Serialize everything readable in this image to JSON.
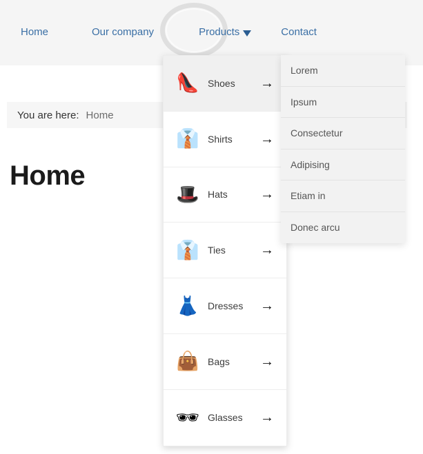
{
  "nav": {
    "items": [
      {
        "label": "Home",
        "has_caret": false
      },
      {
        "label": "Our company",
        "has_caret": false
      },
      {
        "label": "Products",
        "has_caret": true
      },
      {
        "label": "Contact",
        "has_caret": false
      }
    ],
    "active_item": "Products",
    "link_color": "#3a6fa5",
    "band_color": "#f5f5f5"
  },
  "highlight": {
    "target": "Products",
    "shape": "ring",
    "color": "#e2e2e2"
  },
  "breadcrumb": {
    "label": "You are here:",
    "current": "Home"
  },
  "page": {
    "title": "Home"
  },
  "dropdown": {
    "arrow_glyph": "→",
    "active_item": "Shoes",
    "items": [
      {
        "label": "Shoes",
        "icon": "high-heel-shoe-icon",
        "glyph": "👠",
        "active": true
      },
      {
        "label": "Shirts",
        "icon": "shirt-icon",
        "glyph": "👔",
        "active": false
      },
      {
        "label": "Hats",
        "icon": "hat-icon",
        "glyph": "🎩",
        "active": false
      },
      {
        "label": "Ties",
        "icon": "necktie-icon",
        "glyph": "👔",
        "active": false
      },
      {
        "label": "Dresses",
        "icon": "dress-icon",
        "glyph": "👗",
        "active": false
      },
      {
        "label": "Bags",
        "icon": "handbag-icon",
        "glyph": "👜",
        "active": false
      },
      {
        "label": "Glasses",
        "icon": "sunglasses-icon",
        "glyph": "🕶",
        "active": false
      }
    ]
  },
  "submenu": {
    "items": [
      {
        "label": "Lorem"
      },
      {
        "label": "Ipsum"
      },
      {
        "label": "Consectetur"
      },
      {
        "label": "Adipising"
      },
      {
        "label": "Etiam in"
      },
      {
        "label": "Donec arcu"
      }
    ]
  }
}
